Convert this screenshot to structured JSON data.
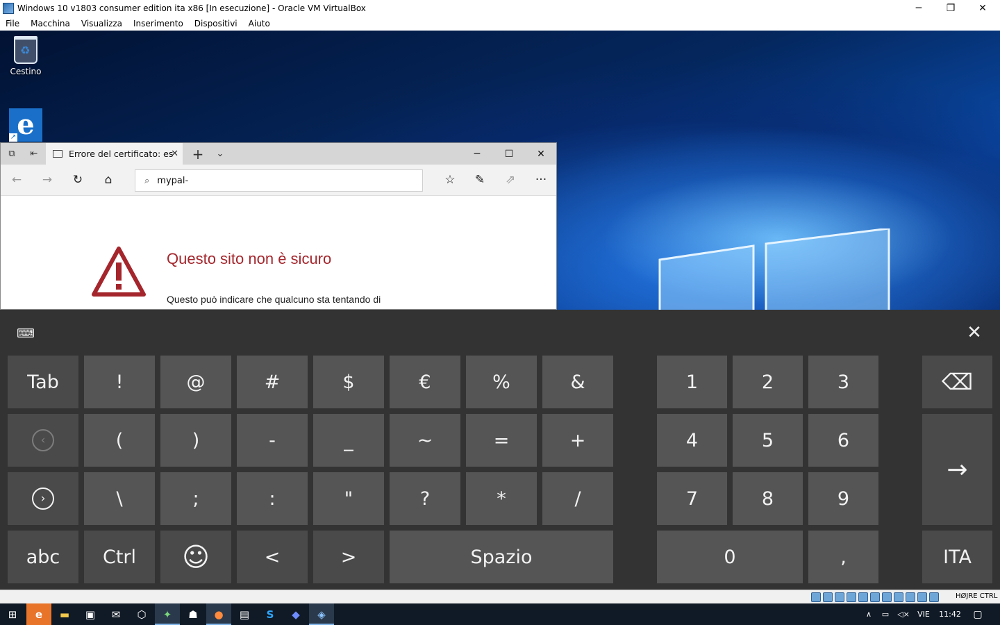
{
  "vbox": {
    "title": "Windows 10 v1803 consumer edition ita x86 [In esecuzione] - Oracle VM VirtualBox",
    "controls": {
      "minimize": "─",
      "restore": "❐",
      "close": "✕"
    },
    "menu": [
      "File",
      "Macchina",
      "Visualizza",
      "Inserimento",
      "Dispositivi",
      "Aiuto"
    ],
    "host_key": "HØJRE CTRL"
  },
  "desktop": {
    "icons": [
      {
        "label": "Cestino",
        "icon": "recycle-bin-icon"
      },
      {
        "label": "",
        "icon": "edge-shortcut-icon"
      }
    ]
  },
  "edge": {
    "tab_title": "Errore del certificato: es",
    "address": "mypal-",
    "glyphs": {
      "set_aside": "⧉",
      "tabs_aside": "⇤",
      "tab_close": "✕",
      "new_tab": "+",
      "tab_list": "⌄",
      "minimize": "─",
      "maximize": "☐",
      "close": "✕",
      "back": "←",
      "forward": "→",
      "refresh": "↻",
      "home": "⌂",
      "search": "⌕",
      "favorites": "☆",
      "notes": "✎",
      "share": "⇗",
      "more": "···"
    },
    "error": {
      "title": "Questo sito non è sicuro",
      "text": "Questo può indicare che qualcuno sta tentando di",
      "color": "#a4262c"
    }
  },
  "keyboard": {
    "settings_glyph": "⌨",
    "close_glyph": "✕",
    "rows": [
      [
        "Tab",
        "!",
        "@",
        "#",
        "$",
        "€",
        "%",
        "&"
      ],
      [
        "‹",
        "(",
        ")",
        "-",
        "_",
        "~",
        "=",
        "+"
      ],
      [
        "›",
        "\\",
        ";",
        ":",
        "\"",
        "?",
        "*",
        "/"
      ],
      [
        "abc",
        "Ctrl",
        "☺",
        "<",
        ">",
        "Spazio"
      ]
    ],
    "numpad": [
      [
        "1",
        "2",
        "3"
      ],
      [
        "4",
        "5",
        "6"
      ],
      [
        "7",
        "8",
        "9"
      ],
      [
        "0",
        ","
      ]
    ],
    "side": {
      "backspace": "⌫",
      "enter": "→",
      "language": "ITA"
    }
  },
  "taskbar": {
    "apps": [
      {
        "icon": "start-icon",
        "glyph": "⊞"
      },
      {
        "icon": "edge-icon",
        "glyph": "e"
      },
      {
        "icon": "file-explorer-icon",
        "glyph": "▬"
      },
      {
        "icon": "store-icon",
        "glyph": "▣"
      },
      {
        "icon": "mail-icon",
        "glyph": "✉"
      },
      {
        "icon": "3d-box-icon",
        "glyph": "⬡"
      },
      {
        "icon": "game-icon",
        "glyph": "✦"
      },
      {
        "icon": "mask-icon",
        "glyph": "☗"
      },
      {
        "icon": "firefox-icon",
        "glyph": "●"
      },
      {
        "icon": "remote-desktop-icon",
        "glyph": "▤"
      },
      {
        "icon": "skype-icon",
        "glyph": "S"
      },
      {
        "icon": "drop-icon",
        "glyph": "◆"
      },
      {
        "icon": "virtualbox-icon",
        "glyph": "◈"
      }
    ],
    "tray": {
      "chevron": "∧",
      "network": "▭",
      "volume": "◁×",
      "language": "VIE",
      "time": "11:42",
      "notifications": "▢"
    }
  }
}
